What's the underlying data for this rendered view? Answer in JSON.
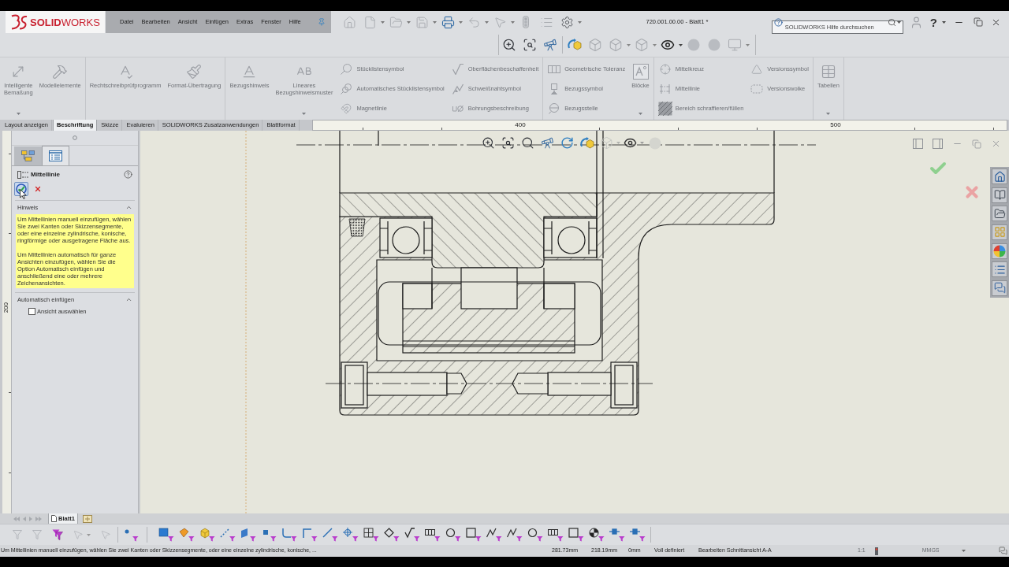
{
  "title_bar": {
    "logo": "**SOLID**WORKS",
    "menus": [
      "Datei",
      "Bearbeiten",
      "Ansicht",
      "Einfügen",
      "Extras",
      "Fenster",
      "Hilfe"
    ],
    "document_title": "720.001.00.00 - Blatt1 *",
    "search": {
      "placeholder": "SOLIDWORKS Hilfe durchsuchen"
    },
    "help_button": "?"
  },
  "ribbon": {
    "groups": [
      {
        "items": [
          {
            "kind": "large_two_line",
            "label": "Intelligente Bemaßung",
            "dropdown": true
          },
          {
            "kind": "large",
            "label": "Modellelemente",
            "dropdown": false
          }
        ]
      },
      {
        "items": [
          {
            "kind": "large",
            "label": "Rechtschreibprüfprogramm",
            "dropdown": false
          },
          {
            "kind": "large",
            "label": "Format-Übertragung",
            "dropdown": false
          }
        ]
      },
      {
        "items": [
          {
            "kind": "large",
            "label": "Bezugshinweis",
            "dropdown": false
          },
          {
            "kind": "large_two_line",
            "label": "Lineares Bezugshinweismuster",
            "dropdown": true
          },
          {
            "kind": "stack",
            "entries": [
              "Stücklistensymbol",
              "Automatisches Stücklistensymbol",
              "Magnetlinie"
            ]
          },
          {
            "kind": "stack",
            "entries": [
              "Oberflächenbeschaffenheit",
              "Schweißnahtsymbol",
              "Bohrungsbeschreibung"
            ]
          }
        ]
      },
      {
        "items": [
          {
            "kind": "stack",
            "entries": [
              "Geometrische Toleranz",
              "Bezugssymbol",
              "Bezugsstelle"
            ]
          },
          {
            "kind": "large",
            "label": "Blöcke",
            "dropdown": true
          }
        ]
      },
      {
        "items": [
          {
            "kind": "stack",
            "entries": [
              "Mittelkreuz",
              "Mittellinie",
              "Bereich schraffieren/füllen"
            ]
          },
          {
            "kind": "stack",
            "entries": [
              "Versionssymbol",
              "Versionswolke"
            ]
          }
        ]
      },
      {
        "items": [
          {
            "kind": "large",
            "label": "Tabellen",
            "dropdown": true
          }
        ]
      }
    ]
  },
  "tabs": [
    {
      "label": "Layout anzeigen",
      "selected": false
    },
    {
      "label": "Beschriftung",
      "selected": true
    },
    {
      "label": "Skizze",
      "selected": false
    },
    {
      "label": "Evaluieren",
      "selected": false
    },
    {
      "label": "SOLIDWORKS Zusatzanwendungen",
      "selected": false
    },
    {
      "label": "Blattformat",
      "selected": false
    }
  ],
  "ruler": {
    "horizontal_labels": [
      "400",
      "500"
    ],
    "vertical_labels": [
      "200"
    ]
  },
  "property_manager": {
    "tabs": [
      {
        "selected": false
      },
      {
        "selected": true
      }
    ],
    "title": "Mittellinie",
    "sections": [
      {
        "kind": "message",
        "title": "Hinweis",
        "expanded": true,
        "paragraphs": [
          "Um Mittellinien manuell einzufügen, wählen Sie zwei Kanten oder Skizzensegmente, oder eine einzelne zylindrische, konische, ringförmige oder ausgetragene Fläche aus.",
          "Um Mittellinien automatisch für ganze Ansichten einzufügen, wählen Sie die Option Automatisch einfügen und anschließend eine oder mehrere Zeichenansichten."
        ]
      },
      {
        "kind": "checkboxes",
        "title": "Automatisch einfügen",
        "expanded": true,
        "options": [
          {
            "label": "Ansicht auswählen",
            "checked": false
          }
        ]
      }
    ]
  },
  "sheet_tabs": [
    {
      "label": "Blatt1",
      "selected": true
    }
  ],
  "status_bar": {
    "message": "Um Mittellinien manuell einzufügen, wählen Sie zwei Kanten oder Skizzensegmente, oder eine einzelne zylindrische, konische, ...",
    "fields": [
      "281.73mm",
      "218.19mm",
      "0mm",
      "Voll definiert",
      "Bearbeiten Schnittansicht A-A"
    ],
    "scale": "1:1",
    "units": "MMGS"
  }
}
